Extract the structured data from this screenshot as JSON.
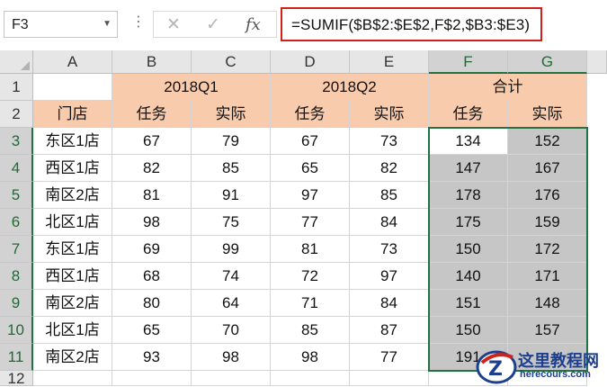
{
  "name_box": {
    "value": "F3",
    "dropdown_icon": "chevron-down-icon"
  },
  "formula_bar": {
    "separator_icon": "vertical-dots-icon",
    "cancel_icon": "close-icon",
    "enter_icon": "checkmark-icon",
    "function_icon": "fx-icon",
    "cancel_glyph": "✕",
    "enter_glyph": "✓",
    "fx_glyph": "fx",
    "formula": "=SUMIF($B$2:$E$2,F$2,$B3:$E3)"
  },
  "columns": [
    "A",
    "B",
    "C",
    "D",
    "E",
    "F",
    "G"
  ],
  "rows": [
    "1",
    "2",
    "3",
    "4",
    "5",
    "6",
    "7",
    "8",
    "9",
    "10",
    "11",
    "12"
  ],
  "header_row1": {
    "b_c": "2018Q1",
    "d_e": "2018Q2",
    "f_g": "合计"
  },
  "header_row2": [
    "门店",
    "任务",
    "实际",
    "任务",
    "实际",
    "任务",
    "实际"
  ],
  "data_rows": [
    [
      "东区1店",
      "67",
      "79",
      "67",
      "73",
      "134",
      "152"
    ],
    [
      "西区1店",
      "82",
      "85",
      "65",
      "82",
      "147",
      "167"
    ],
    [
      "南区2店",
      "81",
      "91",
      "97",
      "85",
      "178",
      "176"
    ],
    [
      "北区1店",
      "98",
      "75",
      "77",
      "84",
      "175",
      "159"
    ],
    [
      "东区1店",
      "69",
      "99",
      "81",
      "73",
      "150",
      "172"
    ],
    [
      "西区1店",
      "68",
      "74",
      "72",
      "97",
      "140",
      "171"
    ],
    [
      "南区2店",
      "80",
      "64",
      "71",
      "84",
      "151",
      "148"
    ],
    [
      "北区1店",
      "65",
      "70",
      "85",
      "87",
      "150",
      "157"
    ],
    [
      "南区2店",
      "93",
      "98",
      "98",
      "77",
      "191",
      ""
    ]
  ],
  "colors": {
    "header_fill": "#f8cbad",
    "selection_fill": "#c6c6c6",
    "selection_border": "#217346",
    "formula_highlight": "#d0221b"
  },
  "watermark": {
    "title": "这里教程网",
    "url": "herecours.com",
    "logo_icon": "watermark-logo-icon"
  }
}
